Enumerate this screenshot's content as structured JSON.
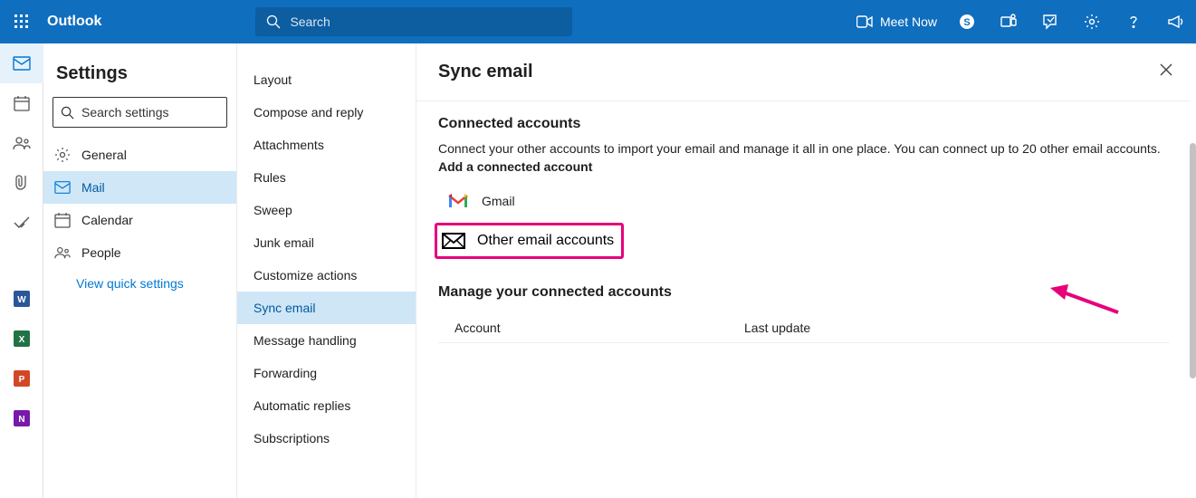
{
  "banner": {
    "brand": "Outlook",
    "search_placeholder": "Search",
    "meet_now": "Meet Now"
  },
  "settings": {
    "title": "Settings",
    "search_placeholder": "Search settings",
    "quick_link": "View quick settings",
    "categories": [
      {
        "label": "General"
      },
      {
        "label": "Mail"
      },
      {
        "label": "Calendar"
      },
      {
        "label": "People"
      }
    ]
  },
  "subnav": {
    "items": [
      "Layout",
      "Compose and reply",
      "Attachments",
      "Rules",
      "Sweep",
      "Junk email",
      "Customize actions",
      "Sync email",
      "Message handling",
      "Forwarding",
      "Automatic replies",
      "Subscriptions"
    ]
  },
  "page": {
    "title": "Sync email",
    "section1_heading": "Connected accounts",
    "section1_desc": "Connect your other accounts to import your email and manage it all in one place. You can connect up to 20 other email accounts.",
    "add_label": "Add a connected account",
    "account_options": [
      {
        "label": "Gmail"
      },
      {
        "label": "Other email accounts"
      }
    ],
    "manage_heading": "Manage your connected accounts",
    "table_headers": {
      "account": "Account",
      "last_update": "Last update"
    }
  }
}
